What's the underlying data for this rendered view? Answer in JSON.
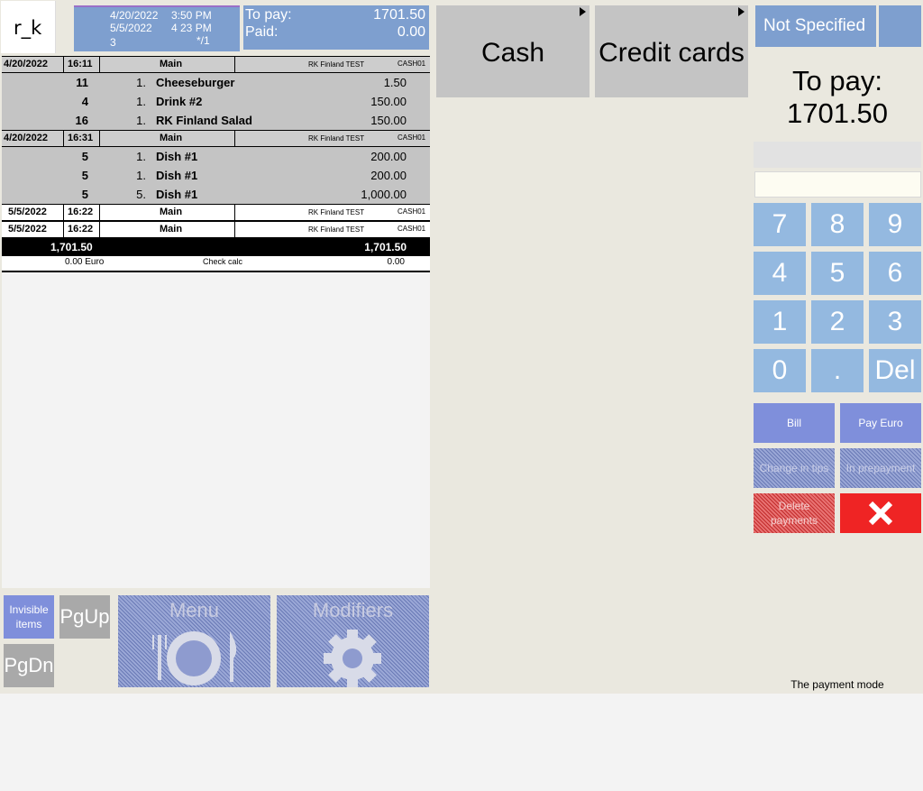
{
  "header": {
    "logo": "r_k",
    "date1": "4/20/2022",
    "time1": "3:50 PM",
    "date2": "5/5/2022",
    "time2": "4 23 PM",
    "guests": "3",
    "table": "*/1",
    "to_pay_label": "To pay:",
    "to_pay_value": "1701.50",
    "paid_label": "Paid:",
    "paid_value": "0.00"
  },
  "order": {
    "groups": [
      {
        "date": "4/20/2022",
        "time": "16:11",
        "place": "Main",
        "restaurant": "RK Finland TEST",
        "station": "CASH01",
        "items": [
          {
            "code": "11",
            "qty": "1.",
            "name": "Cheeseburger",
            "price": "1.50"
          },
          {
            "code": "4",
            "qty": "1.",
            "name": "Drink #2",
            "price": "150.00"
          },
          {
            "code": "16",
            "qty": "1.",
            "name": "RK Finland Salad",
            "price": "150.00"
          }
        ]
      },
      {
        "date": "4/20/2022",
        "time": "16:31",
        "place": "Main",
        "restaurant": "RK Finland TEST",
        "station": "CASH01",
        "items": [
          {
            "code": "5",
            "qty": "1.",
            "name": "Dish #1",
            "price": "200.00"
          },
          {
            "code": "5",
            "qty": "1.",
            "name": "Dish #1",
            "price": "200.00"
          },
          {
            "code": "5",
            "qty": "5.",
            "name": "Dish #1",
            "price": "1,000.00"
          }
        ]
      },
      {
        "date": "5/5/2022",
        "time": "16:22",
        "place": "Main",
        "restaurant": "RK Finland TEST",
        "station": "CASH01",
        "items": []
      },
      {
        "date": "5/5/2022",
        "time": "16:22",
        "place": "Main",
        "restaurant": "RK Finland TEST",
        "station": "CASH01",
        "items": []
      }
    ],
    "total_left": "1,701.50",
    "total_right": "1,701.50",
    "calc_amount": "0.00 Euro",
    "calc_label": "Check calc",
    "calc_value": "0.00"
  },
  "payment_types": {
    "cash": "Cash",
    "credit_cards": "Credit cards"
  },
  "right_panel": {
    "currency": "Not Specified",
    "to_pay_label": "To pay:",
    "to_pay_value": "1701.50",
    "keys": [
      "7",
      "8",
      "9",
      "4",
      "5",
      "6",
      "1",
      "2",
      "3",
      "0",
      ".",
      "Del"
    ],
    "bill": "Bill",
    "pay_euro": "Pay Euro",
    "change_in_tips": "Change in tips",
    "in_prepayment": "In prepayment",
    "delete_payments": "Delete payments",
    "cancel_icon": "close-icon",
    "mode_text": "The payment mode"
  },
  "bottom": {
    "invisible_items": "Invisible items",
    "pgup": "PgUp",
    "pgdn": "PgDn",
    "menu": "Menu",
    "modifiers": "Modifiers"
  },
  "colors": {
    "accent_blue": "#7e9fcf",
    "key_blue": "#94b9e0",
    "bill_blue": "#7f8fdb",
    "cancel_red": "#ef2424"
  }
}
